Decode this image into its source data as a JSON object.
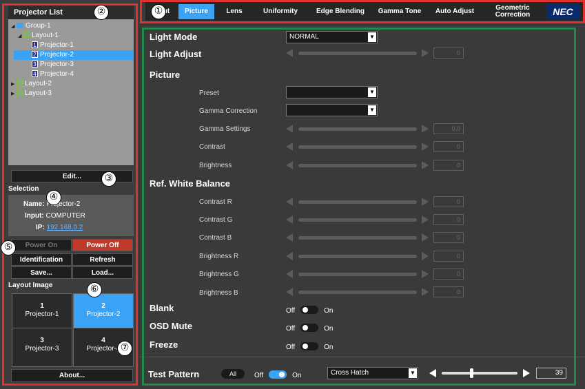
{
  "left": {
    "title": "Projector List",
    "tree": [
      {
        "label": "Group-1",
        "kind": "folder",
        "indent": 0
      },
      {
        "label": "Layout-1",
        "kind": "grid",
        "indent": 1
      },
      {
        "label": "Projector-1",
        "kind": "num",
        "num": "1",
        "indent": 2
      },
      {
        "label": "Projector-2",
        "kind": "num",
        "num": "2",
        "indent": 2,
        "selected": true
      },
      {
        "label": "Projector-3",
        "kind": "num",
        "num": "3",
        "indent": 2
      },
      {
        "label": "Projector-4",
        "kind": "num",
        "num": "4",
        "indent": 2
      },
      {
        "label": "Layout-2",
        "kind": "grid",
        "indent": 0
      },
      {
        "label": "Layout-3",
        "kind": "grid",
        "indent": 0
      }
    ],
    "edit_label": "Edit...",
    "selection_title": "Selection",
    "name_label": "Name:",
    "name_value": "Projector-2",
    "input_label": "Input:",
    "input_value": "COMPUTER",
    "ip_label": "IP:",
    "ip_value": "192.168.0.2",
    "power_on": "Power On",
    "power_off": "Power Off",
    "identification": "Identification",
    "refresh": "Refresh",
    "save": "Save...",
    "load": "Load...",
    "layout_image_title": "Layout Image",
    "tiles": [
      {
        "num": "1",
        "label": "Projector-1"
      },
      {
        "num": "2",
        "label": "Projector-2"
      },
      {
        "num": "3",
        "label": "Projector-3"
      },
      {
        "num": "4",
        "label": "Projector-4"
      }
    ],
    "about": "About..."
  },
  "tabs": [
    "Input",
    "Picture",
    "Lens",
    "Uniformity",
    "Edge Blending",
    "Gamma Tone",
    "Auto Adjust",
    "Geometric Correction"
  ],
  "brand": "NEC",
  "main": {
    "light_mode": "Light Mode",
    "light_mode_value": "NORMAL",
    "light_adjust": "Light Adjust",
    "light_adjust_value": "0",
    "picture": "Picture",
    "preset": "Preset",
    "gamma_correction": "Gamma Correction",
    "gamma_settings": "Gamma Settings",
    "gamma_settings_value": "0.0",
    "contrast": "Contrast",
    "contrast_value": "0",
    "brightness": "Brightness",
    "brightness_value": "0",
    "ref_white_balance": "Ref. White Balance",
    "contrast_r": "Contrast R",
    "contrast_g": "Contrast G",
    "contrast_b": "Contrast B",
    "brightness_r": "Brightness R",
    "brightness_g": "Brightness G",
    "brightness_b": "Brightness B",
    "wb_value": "0",
    "blank": "Blank",
    "osd_mute": "OSD Mute",
    "freeze": "Freeze",
    "off": "Off",
    "on": "On"
  },
  "bottom": {
    "test_pattern": "Test Pattern",
    "all": "All",
    "off": "Off",
    "on": "On",
    "pattern": "Cross Hatch",
    "value": "39",
    "level_fraction": 0.39
  },
  "callouts": [
    "①",
    "②",
    "③",
    "④",
    "⑤",
    "⑥",
    "⑦"
  ],
  "colors": {
    "accent": "#3aa3f5",
    "highlight_red": "#e23030",
    "highlight_green": "#1f8a4a",
    "brand_bg": "#0a2a6e",
    "power_off_bg": "#c0392b"
  }
}
